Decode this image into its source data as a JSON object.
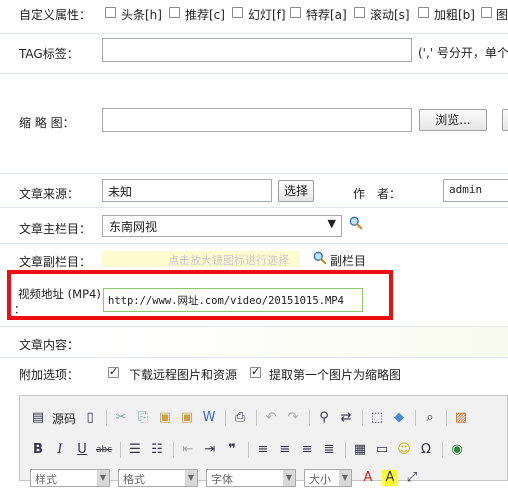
{
  "attrs": {
    "label": "自定义属性：",
    "options": [
      {
        "text": "头条[h]",
        "checked": false
      },
      {
        "text": "推荐[c]",
        "checked": false
      },
      {
        "text": "幻灯[f]",
        "checked": false
      },
      {
        "text": "特荐[a]",
        "checked": false
      },
      {
        "text": "滚动[s]",
        "checked": false
      },
      {
        "text": "加粗[b]",
        "checked": false
      },
      {
        "text": "图",
        "checked": false
      }
    ]
  },
  "tag": {
    "label": "TAG标签：",
    "value": "",
    "hint": "(',' 号分开，单个"
  },
  "thumb": {
    "label": "缩 略 图：",
    "value": "",
    "browse": "浏览..."
  },
  "source": {
    "label": "文章来源：",
    "value": "未知",
    "select_btn": "选择",
    "author_label": "作　者：",
    "author_value": "admin"
  },
  "main_column": {
    "label": "文章主栏目：",
    "value": "东南网视"
  },
  "sub_column": {
    "label": "文章副栏目：",
    "hint": "点击放大镜图标进行选择",
    "link": "副栏目"
  },
  "video": {
    "label": "视频地址 (MP4)",
    "label_suffix": "：",
    "value": "http://www.网址.com/video/20151015.MP4"
  },
  "content": {
    "label": "文章内容："
  },
  "extra": {
    "label": "附加选项：",
    "opt1": "下载远程图片和资源",
    "opt2": "提取第一个图片为缩略图",
    "opt1_checked": true,
    "opt2_checked": true
  },
  "editor": {
    "source_label": "源码",
    "style_combo": "样式",
    "format_combo": "格式",
    "font_combo": "字体",
    "size_combo": "大小"
  }
}
